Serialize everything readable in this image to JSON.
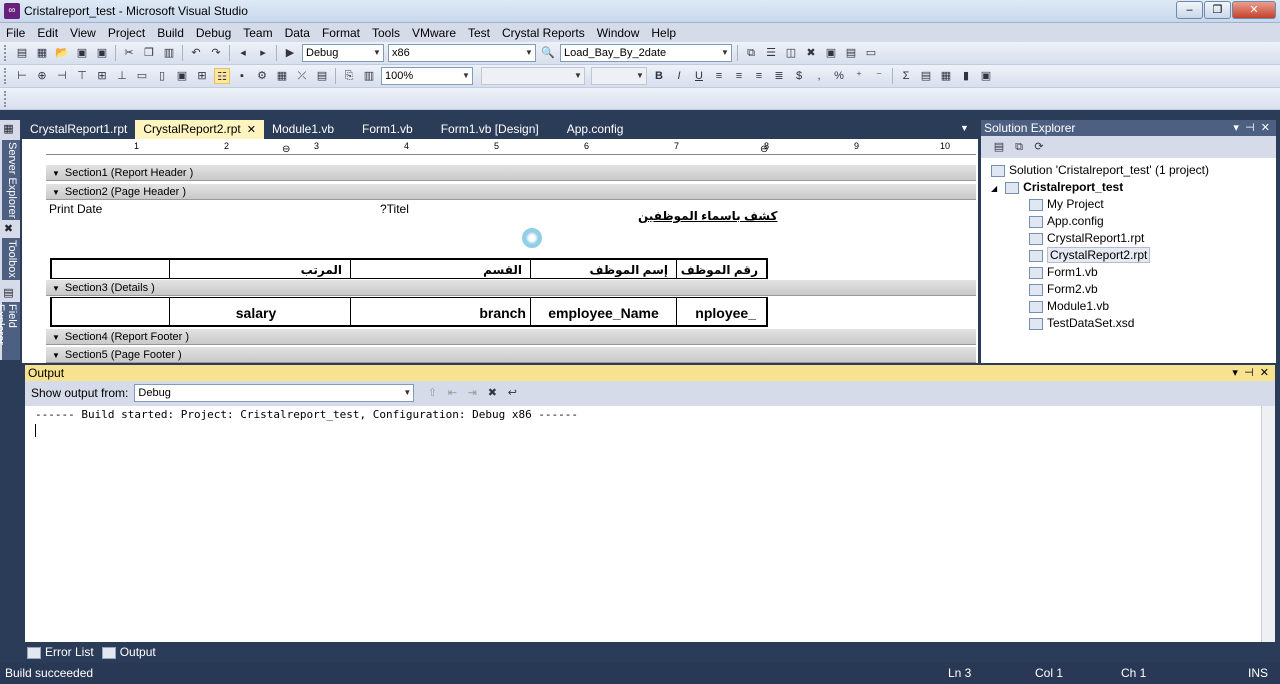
{
  "window": {
    "title": "Cristalreport_test - Microsoft Visual Studio",
    "app_icon": "visual-studio-icon"
  },
  "menu": [
    "File",
    "Edit",
    "View",
    "Project",
    "Build",
    "Debug",
    "Team",
    "Data",
    "Format",
    "Tools",
    "VMware",
    "Test",
    "Crystal Reports",
    "Window",
    "Help"
  ],
  "toolbar": {
    "config": "Debug",
    "platform": "x86",
    "find": "Load_Bay_By_2date",
    "zoom": "100%",
    "font_name": "",
    "font_size": ""
  },
  "sidebar": {
    "server_explorer": "Server Explorer",
    "toolbox": "Toolbox",
    "field_explorer": "Field Explorer"
  },
  "tabs": [
    {
      "label": "CrystalReport1.rpt",
      "active": false
    },
    {
      "label": "CrystalReport2.rpt",
      "active": true
    },
    {
      "label": "Module1.vb",
      "active": false
    },
    {
      "label": "Form1.vb",
      "active": false
    },
    {
      "label": "Form1.vb [Design]",
      "active": false
    },
    {
      "label": "App.config",
      "active": false
    }
  ],
  "designer": {
    "ruler": [
      "1",
      "2",
      "3",
      "4",
      "5",
      "6",
      "7",
      "8",
      "9",
      "10"
    ],
    "sections": {
      "s1": "Section1 (Report Header )",
      "s2": "Section2 (Page Header )",
      "s3": "Section3 (Details )",
      "s4": "Section4 (Report Footer )",
      "s5": "Section5 (Page Footer )"
    },
    "page_header": {
      "print_date": "Print Date",
      "title_field": "?Titel",
      "report_title": "كشف باسماء الموظفين",
      "col_salary": "المرتب",
      "col_branch": "القسم",
      "col_name": "إسم الموظف",
      "col_id": "رقم الموظف"
    },
    "details": {
      "salary": "salary",
      "branch": "branch",
      "name": "employee_Name",
      "id": "nployee_"
    }
  },
  "solution_explorer": {
    "title": "Solution Explorer",
    "items": [
      {
        "label": "Solution 'Cristalreport_test' (1 project)",
        "level": 0,
        "bold": false
      },
      {
        "label": "Cristalreport_test",
        "level": 1,
        "bold": true
      },
      {
        "label": "My Project",
        "level": 2,
        "bold": false
      },
      {
        "label": "App.config",
        "level": 2,
        "bold": false
      },
      {
        "label": "CrystalReport1.rpt",
        "level": 2,
        "bold": false
      },
      {
        "label": "CrystalReport2.rpt",
        "level": 2,
        "bold": false,
        "selected": true
      },
      {
        "label": "Form1.vb",
        "level": 2,
        "bold": false
      },
      {
        "label": "Form2.vb",
        "level": 2,
        "bold": false
      },
      {
        "label": "Module1.vb",
        "level": 2,
        "bold": false
      },
      {
        "label": "TestDataSet.xsd",
        "level": 2,
        "bold": false
      }
    ]
  },
  "output": {
    "title": "Output",
    "show_from_label": "Show output from:",
    "show_from_value": "Debug",
    "text": "------ Build started: Project: Cristalreport_test, Configuration: Debug x86 ------"
  },
  "bottom_tabs": [
    "Error List",
    "Output"
  ],
  "status": {
    "message": "Build succeeded",
    "ln": "Ln 3",
    "col": "Col 1",
    "ch": "Ch 1",
    "mode": "INS"
  }
}
